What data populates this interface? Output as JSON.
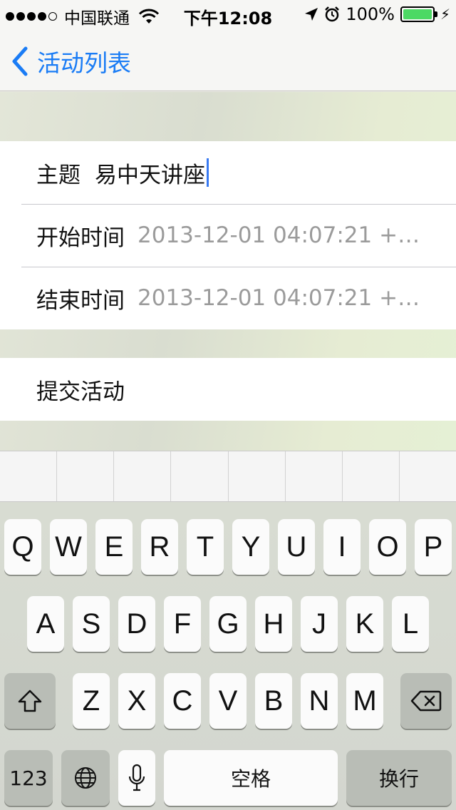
{
  "status_bar": {
    "carrier": "中国联通",
    "time": "下午12:08",
    "battery": "100%",
    "battery_level": 1.0,
    "signal_bars": 4,
    "signal_total": 5,
    "icons": [
      "wifi-icon",
      "location-icon",
      "alarm-icon",
      "battery-icon",
      "charging-icon"
    ]
  },
  "nav": {
    "back_label": "活动列表",
    "tint_color": "#1a7cf5"
  },
  "form": {
    "topic": {
      "label": "主题",
      "value": "易中天讲座"
    },
    "start_time": {
      "label": "开始时间",
      "value": "2013-12-01 04:07:21 +0..."
    },
    "end_time": {
      "label": "结束时间",
      "value": "2013-12-01 04:07:21 +0..."
    },
    "submit_label": "提交活动"
  },
  "keyboard": {
    "row1": [
      "Q",
      "W",
      "E",
      "R",
      "T",
      "Y",
      "U",
      "I",
      "O",
      "P"
    ],
    "row2": [
      "A",
      "S",
      "D",
      "F",
      "G",
      "H",
      "J",
      "K",
      "L"
    ],
    "row3": [
      "Z",
      "X",
      "C",
      "V",
      "B",
      "N",
      "M"
    ],
    "numbers_label": "123",
    "space_label": "空格",
    "return_label": "换行",
    "icons": [
      "shift-icon",
      "delete-icon",
      "globe-icon",
      "microphone-icon"
    ]
  }
}
